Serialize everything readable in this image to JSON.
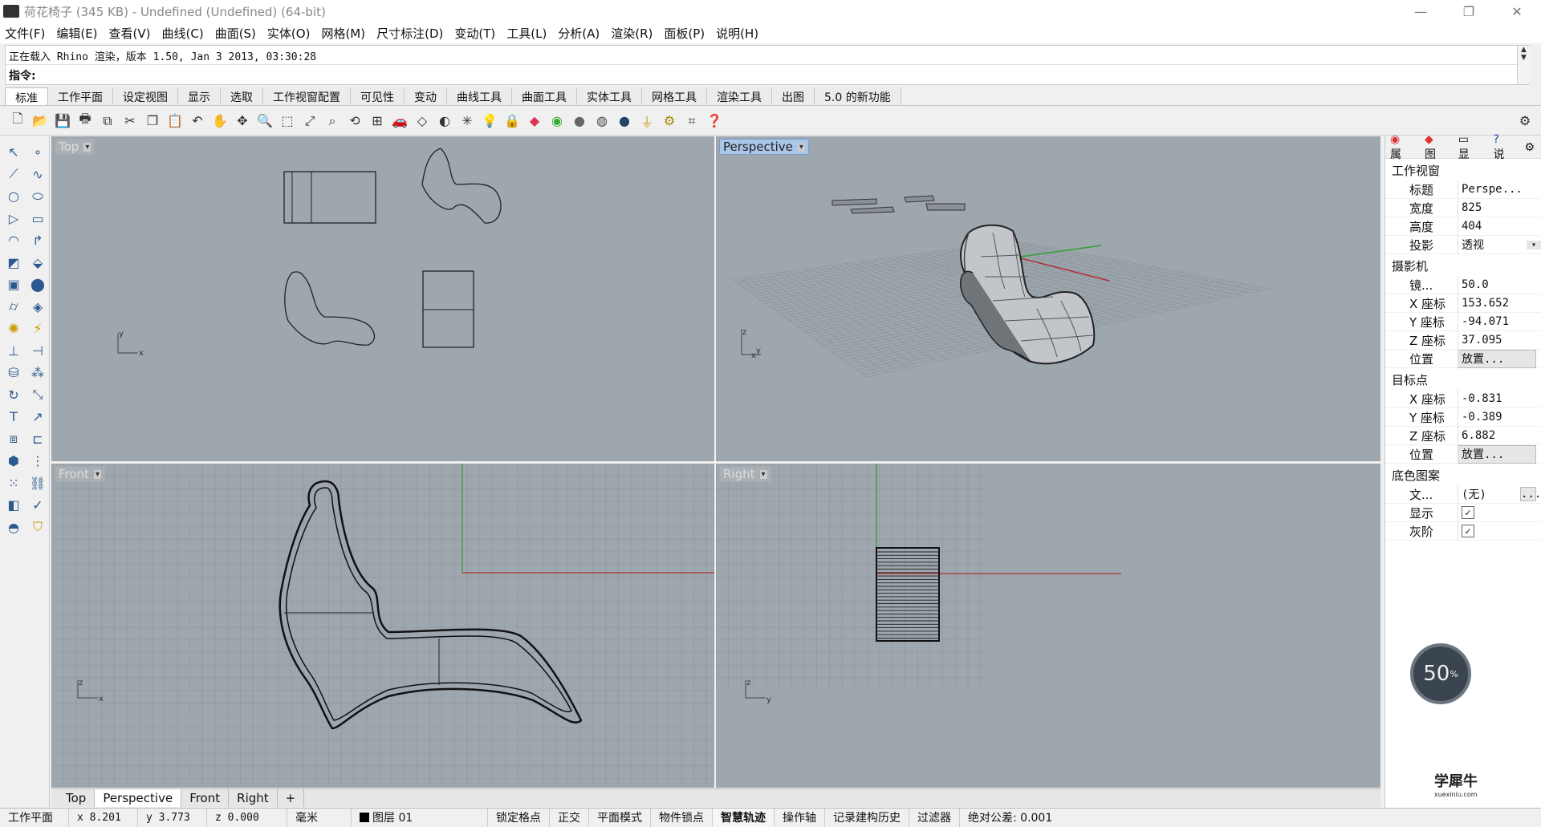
{
  "window": {
    "title": "荷花椅子 (345 KB) - Undefined (Undefined) (64-bit)",
    "controls": [
      "—",
      "❐",
      "✕"
    ]
  },
  "menu": [
    "文件(F)",
    "编辑(E)",
    "查看(V)",
    "曲线(C)",
    "曲面(S)",
    "实体(O)",
    "网格(M)",
    "尺寸标注(D)",
    "变动(T)",
    "工具(L)",
    "分析(A)",
    "渲染(R)",
    "面板(P)",
    "说明(H)"
  ],
  "command": {
    "history": "正在载入 Rhino 渲染，版本 1.50, Jan  3 2013, 03:30:28",
    "prompt": "指令:"
  },
  "toolbar_tabs": [
    "标准",
    "工作平面",
    "设定视图",
    "显示",
    "选取",
    "工作视窗配置",
    "可见性",
    "变动",
    "曲线工具",
    "曲面工具",
    "实体工具",
    "网格工具",
    "渲染工具",
    "出图",
    "5.0 的新功能"
  ],
  "toolbar_icons": [
    "new-icon",
    "open-icon",
    "save-icon",
    "print-icon",
    "export-icon",
    "cut-icon",
    "copy-icon",
    "paste-icon",
    "undo-icon",
    "pan-icon",
    "move-view-icon",
    "zoom-icon",
    "zoom-window-icon",
    "zoom-extents-icon",
    "zoom-selected-icon",
    "rotate-view-icon",
    "viewport-layout-icon",
    "car-icon",
    "wireframe-icon",
    "shade-icon",
    "light-icon",
    "bulb-icon",
    "lock-icon",
    "layer-icon",
    "color-wheel-icon",
    "material-icon",
    "render-icon",
    "sphere-icon",
    "filter-icon",
    "options-icon",
    "grid-snap-icon",
    "help-icon"
  ],
  "viewports": {
    "top": "Top",
    "perspective": "Perspective",
    "front": "Front",
    "right": "Right"
  },
  "viewport_tabs": [
    "Top",
    "Perspective",
    "Front",
    "Right",
    "+"
  ],
  "properties": {
    "tabs": [
      "属",
      "图",
      "显",
      "说"
    ],
    "section_viewport": "工作视窗",
    "title_label": "标题",
    "title_value": "Perspe...",
    "width_label": "宽度",
    "width_value": "825",
    "height_label": "高度",
    "height_value": "404",
    "projection_label": "投影",
    "projection_value": "透视",
    "section_camera": "摄影机",
    "lens_label": "镜...",
    "lens_value": "50.0",
    "cam_x_label": "X 座标",
    "cam_x_value": "153.652",
    "cam_y_label": "Y 座标",
    "cam_y_value": "-94.071",
    "cam_z_label": "Z 座标",
    "cam_z_value": "37.095",
    "cam_pos_label": "位置",
    "cam_pos_button": "放置...",
    "section_target": "目标点",
    "tgt_x_label": "X 座标",
    "tgt_x_value": "-0.831",
    "tgt_y_label": "Y 座标",
    "tgt_y_value": "-0.389",
    "tgt_z_label": "Z 座标",
    "tgt_z_value": "6.882",
    "tgt_pos_label": "位置",
    "tgt_pos_button": "放置...",
    "section_bg": "底色图案",
    "file_label": "文...",
    "file_value": "(无)",
    "file_button": "...",
    "show_label": "显示",
    "gray_label": "灰阶"
  },
  "gauge": {
    "value": "50",
    "unit": "%"
  },
  "watermark": {
    "main": "学犀牛",
    "sub": "xuexiniu.com"
  },
  "status": {
    "cplane": "工作平面",
    "x": "x 8.201",
    "y": "y 3.773",
    "z": "z 0.000",
    "units": "毫米",
    "layer": "图层 01",
    "grid_snap": "锁定格点",
    "ortho": "正交",
    "planar": "平面模式",
    "osnap": "物件锁点",
    "smarttrack": "智慧轨迹",
    "gumball": "操作轴",
    "history": "记录建构历史",
    "filter": "过滤器",
    "tolerance": "绝对公差: 0.001"
  },
  "colors": {
    "viewport_bg": "#9ea6ae",
    "x_axis": "#b03030",
    "y_axis": "#30a030",
    "active_label": "#a9c6e6"
  }
}
